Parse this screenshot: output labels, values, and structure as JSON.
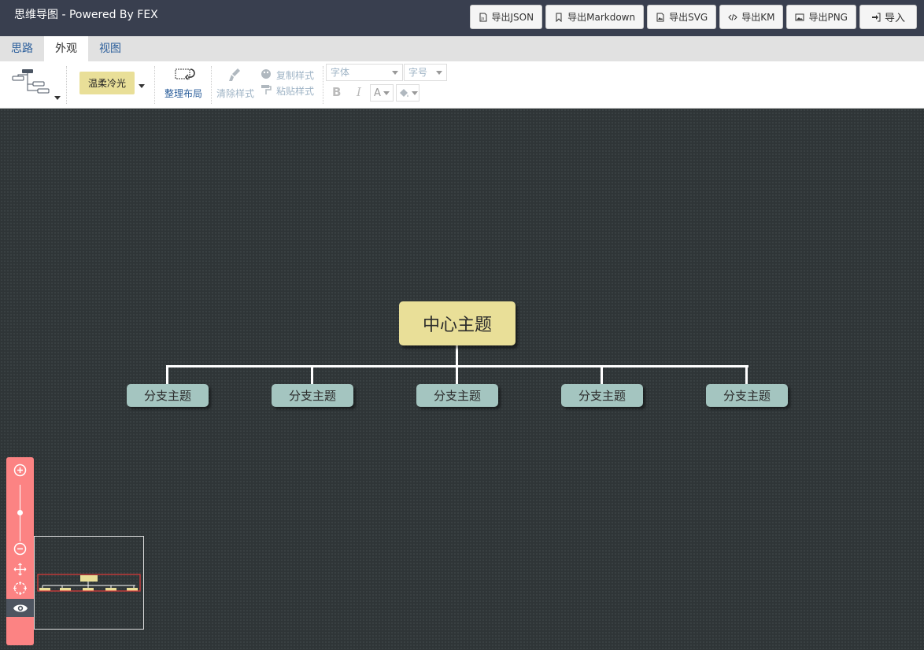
{
  "app": {
    "title": "思维导图 - Powered By FEX"
  },
  "export_buttons": [
    {
      "label": "导出JSON",
      "icon": "file-json-icon"
    },
    {
      "label": "导出Markdown",
      "icon": "bookmark-icon"
    },
    {
      "label": "导出SVG",
      "icon": "image-file-icon"
    },
    {
      "label": "导出KM",
      "icon": "code-icon"
    },
    {
      "label": "导出PNG",
      "icon": "picture-icon"
    }
  ],
  "import_button": {
    "label": "导入",
    "icon": "sign-in-icon"
  },
  "tabs": [
    {
      "label": "思路",
      "active": false
    },
    {
      "label": "外观",
      "active": true
    },
    {
      "label": "视图",
      "active": false
    }
  ],
  "toolbar": {
    "theme": "温柔冷光",
    "arrange": "整理布局",
    "clear_style": "清除样式",
    "copy_style": "复制样式",
    "paste_style": "粘贴样式",
    "font_family_placeholder": "字体",
    "font_size_placeholder": "字号",
    "bold": "B",
    "italic": "I",
    "font_color": "A"
  },
  "mindmap": {
    "root": "中心主题",
    "branches": [
      "分支主题",
      "分支主题",
      "分支主题",
      "分支主题",
      "分支主题"
    ]
  },
  "colors": {
    "header_bg": "#393f4f",
    "canvas_bg": "#2f3537",
    "root_fill": "#e9df98",
    "branch_fill": "#a4c5c0",
    "zoom_panel": "#fc8383"
  }
}
